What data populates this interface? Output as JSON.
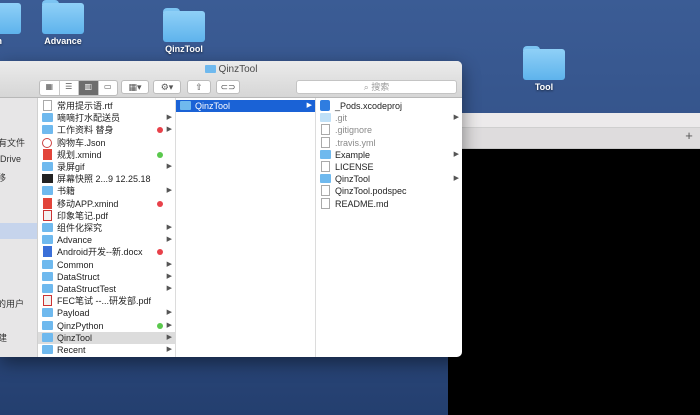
{
  "desktop": {
    "icons": [
      {
        "label": "on"
      },
      {
        "label": "Advance"
      },
      {
        "label": "QinzTool"
      },
      {
        "label": "Tool"
      }
    ]
  },
  "finder": {
    "title": "QinzTool",
    "search_placeholder": "搜索",
    "sidebar_items": [
      "有文件",
      "Drive",
      "移",
      "",
      "的用户",
      "建"
    ],
    "column1": [
      {
        "name": "常用提示语.rtf",
        "icon": "file"
      },
      {
        "name": "嘀嘀打水配送员",
        "icon": "folder",
        "chev": true
      },
      {
        "name": "工作资料 替身",
        "icon": "folder",
        "dot": "#e8414a",
        "chev": true
      },
      {
        "name": "购物车.Json",
        "icon": "json"
      },
      {
        "name": "规划.xmind",
        "icon": "red",
        "dot": "#5ac84d"
      },
      {
        "name": "录屏gif",
        "icon": "folder",
        "chev": true
      },
      {
        "name": "屏幕快照 2...9 12.25.18",
        "icon": "dark"
      },
      {
        "name": "书籍",
        "icon": "folder",
        "chev": true
      },
      {
        "name": "移动APP.xmind",
        "icon": "red",
        "dot": "#e8414a"
      },
      {
        "name": "印象笔记.pdf",
        "icon": "pdf"
      },
      {
        "name": "组件化探究",
        "icon": "folder",
        "chev": true
      },
      {
        "name": "Advance",
        "icon": "folder",
        "chev": true
      },
      {
        "name": "Android开发--新.docx",
        "icon": "doc",
        "dot": "#e8414a"
      },
      {
        "name": "Common",
        "icon": "folder",
        "chev": true
      },
      {
        "name": "DataStruct",
        "icon": "folder",
        "chev": true
      },
      {
        "name": "DataStructTest",
        "icon": "folder",
        "chev": true
      },
      {
        "name": "FEC笔试 --...研发部.pdf",
        "icon": "pdf"
      },
      {
        "name": "Payload",
        "icon": "folder",
        "chev": true
      },
      {
        "name": "QinzPython",
        "icon": "folder",
        "dot": "#5ac84d",
        "chev": true
      },
      {
        "name": "QinzTool",
        "icon": "folder",
        "chev": true,
        "selected": true
      },
      {
        "name": "Recent",
        "icon": "folder",
        "chev": true
      }
    ],
    "column2": [
      {
        "name": "QinzTool",
        "icon": "folder",
        "chev": true,
        "selected": true
      }
    ],
    "column3": [
      {
        "name": "_Pods.xcodeproj",
        "icon": "xcode"
      },
      {
        "name": ".git",
        "icon": "folder-dim",
        "chev": true,
        "dim": true
      },
      {
        "name": ".gitignore",
        "icon": "file",
        "dim": true
      },
      {
        "name": ".travis.yml",
        "icon": "file",
        "dim": true
      },
      {
        "name": "Example",
        "icon": "folder",
        "chev": true
      },
      {
        "name": "LICENSE",
        "icon": "file"
      },
      {
        "name": "QinzTool",
        "icon": "folder",
        "chev": true
      },
      {
        "name": "QinzTool.podspec",
        "icon": "file"
      },
      {
        "name": "README.md",
        "icon": "file"
      }
    ]
  },
  "terminal": {
    "plus_label": "+"
  }
}
